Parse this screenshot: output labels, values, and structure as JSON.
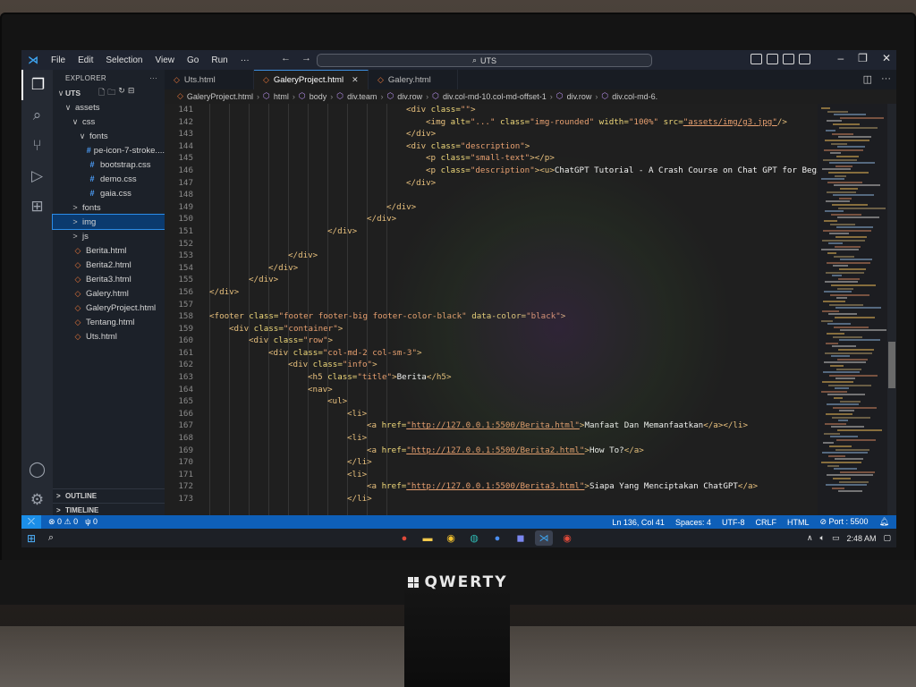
{
  "window": {
    "menu": [
      "File",
      "Edit",
      "Selection",
      "View",
      "Go",
      "Run",
      "···"
    ],
    "search_text": "UTS"
  },
  "activity_bar": {
    "icons": [
      "files-icon",
      "search-icon",
      "source-control-icon",
      "run-debug-icon",
      "extensions-icon",
      "account-icon",
      "settings-gear-icon"
    ]
  },
  "explorer": {
    "title": "EXPLORER",
    "more": "···",
    "root": "UTS",
    "tree": [
      {
        "indent": 1,
        "chev": "∨",
        "icon": "",
        "label": "assets"
      },
      {
        "indent": 2,
        "chev": "∨",
        "icon": "",
        "label": "css"
      },
      {
        "indent": 3,
        "chev": "∨",
        "icon": "",
        "label": "fonts"
      },
      {
        "indent": 4,
        "chev": "",
        "icon": "#",
        "kind": "css",
        "label": "pe-icon-7-stroke...."
      },
      {
        "indent": 3,
        "chev": "",
        "icon": "#",
        "kind": "css",
        "label": "bootstrap.css"
      },
      {
        "indent": 3,
        "chev": "",
        "icon": "#",
        "kind": "css",
        "label": "demo.css"
      },
      {
        "indent": 3,
        "chev": "",
        "icon": "#",
        "kind": "css",
        "label": "gaia.css"
      },
      {
        "indent": 2,
        "chev": ">",
        "icon": "",
        "label": "fonts"
      },
      {
        "indent": 2,
        "chev": ">",
        "icon": "",
        "label": "img",
        "selected": true
      },
      {
        "indent": 2,
        "chev": ">",
        "icon": "",
        "label": "js"
      },
      {
        "indent": 1,
        "chev": "",
        "icon": "◇",
        "kind": "html",
        "label": "Berita.html"
      },
      {
        "indent": 1,
        "chev": "",
        "icon": "◇",
        "kind": "html",
        "label": "Berita2.html"
      },
      {
        "indent": 1,
        "chev": "",
        "icon": "◇",
        "kind": "html",
        "label": "Berita3.html"
      },
      {
        "indent": 1,
        "chev": "",
        "icon": "◇",
        "kind": "html",
        "label": "Galery.html"
      },
      {
        "indent": 1,
        "chev": "",
        "icon": "◇",
        "kind": "html",
        "label": "GaleryProject.html"
      },
      {
        "indent": 1,
        "chev": "",
        "icon": "◇",
        "kind": "html",
        "label": "Tentang.html"
      },
      {
        "indent": 1,
        "chev": "",
        "icon": "◇",
        "kind": "html",
        "label": "Uts.html"
      }
    ],
    "outline": "OUTLINE",
    "timeline": "TIMELINE"
  },
  "tabs": [
    {
      "label": "Uts.html",
      "active": false
    },
    {
      "label": "GaleryProject.html",
      "active": true
    },
    {
      "label": "Galery.html",
      "active": false
    }
  ],
  "breadcrumb": [
    "GaleryProject.html",
    "html",
    "body",
    "div.team",
    "div.row",
    "div.col-md-10.col-md-offset-1",
    "div.row",
    "div.col-md-6."
  ],
  "code_lines": [
    {
      "n": "141",
      "indent": 20,
      "tokens": [
        [
          "tag",
          "<div "
        ],
        [
          "attr",
          "class="
        ],
        [
          "str",
          "\"\""
        ],
        [
          "tag",
          ">"
        ]
      ]
    },
    {
      "n": "142",
      "indent": 22,
      "tokens": [
        [
          "tag",
          "<img "
        ],
        [
          "attr",
          "alt="
        ],
        [
          "str",
          "\"...\""
        ],
        [
          "attr",
          " class="
        ],
        [
          "str",
          "\"img-rounded\""
        ],
        [
          "attr",
          " width="
        ],
        [
          "str",
          "\"100%\""
        ],
        [
          "attr",
          " src="
        ],
        [
          "url",
          "\"assets/img/g3.jpg\""
        ],
        [
          "tag",
          "/>"
        ]
      ]
    },
    {
      "n": "143",
      "indent": 20,
      "tokens": [
        [
          "tag",
          "</div>"
        ]
      ]
    },
    {
      "n": "144",
      "indent": 20,
      "tokens": [
        [
          "tag",
          "<div "
        ],
        [
          "attr",
          "class="
        ],
        [
          "str",
          "\"description\""
        ],
        [
          "tag",
          ">"
        ]
      ]
    },
    {
      "n": "145",
      "indent": 22,
      "tokens": [
        [
          "tag",
          "<p "
        ],
        [
          "attr",
          "class="
        ],
        [
          "str",
          "\"small-text\""
        ],
        [
          "tag",
          "></p>"
        ]
      ]
    },
    {
      "n": "146",
      "indent": 22,
      "tokens": [
        [
          "tag",
          "<p "
        ],
        [
          "attr",
          "class="
        ],
        [
          "str",
          "\"description\""
        ],
        [
          "tag",
          "><u>"
        ],
        [
          "txt",
          "ChatGPT Tutorial - A Crash Course on Chat GPT for Beginners"
        ],
        [
          "tag",
          "</"
        ]
      ]
    },
    {
      "n": "147",
      "indent": 20,
      "tokens": [
        [
          "tag",
          "</div>"
        ]
      ]
    },
    {
      "n": "148",
      "indent": 0,
      "tokens": []
    },
    {
      "n": "149",
      "indent": 18,
      "tokens": [
        [
          "tag",
          "</div>"
        ]
      ]
    },
    {
      "n": "150",
      "indent": 16,
      "tokens": [
        [
          "tag",
          "</div>"
        ]
      ]
    },
    {
      "n": "151",
      "indent": 12,
      "tokens": [
        [
          "tag",
          "</div>"
        ]
      ]
    },
    {
      "n": "152",
      "indent": 0,
      "tokens": []
    },
    {
      "n": "153",
      "indent": 8,
      "tokens": [
        [
          "tag",
          "</div>"
        ]
      ]
    },
    {
      "n": "154",
      "indent": 6,
      "tokens": [
        [
          "tag",
          "</div>"
        ]
      ]
    },
    {
      "n": "155",
      "indent": 4,
      "tokens": [
        [
          "tag",
          "</div>"
        ]
      ]
    },
    {
      "n": "156",
      "indent": 0,
      "tokens": [
        [
          "tag",
          "</div>"
        ]
      ]
    },
    {
      "n": "157",
      "indent": 0,
      "tokens": []
    },
    {
      "n": "158",
      "indent": 0,
      "tokens": [
        [
          "tag",
          "<footer "
        ],
        [
          "attr",
          "class="
        ],
        [
          "str",
          "\"footer footer-big footer-color-black\""
        ],
        [
          "attr",
          " data-color="
        ],
        [
          "str",
          "\"black\""
        ],
        [
          "tag",
          ">"
        ]
      ]
    },
    {
      "n": "159",
      "indent": 2,
      "tokens": [
        [
          "tag",
          "<div "
        ],
        [
          "attr",
          "class="
        ],
        [
          "str",
          "\"container\""
        ],
        [
          "tag",
          ">"
        ]
      ]
    },
    {
      "n": "160",
      "indent": 4,
      "tokens": [
        [
          "tag",
          "<div "
        ],
        [
          "attr",
          "class="
        ],
        [
          "str",
          "\"row\""
        ],
        [
          "tag",
          ">"
        ]
      ]
    },
    {
      "n": "161",
      "indent": 6,
      "tokens": [
        [
          "tag",
          "<div "
        ],
        [
          "attr",
          "class="
        ],
        [
          "str",
          "\"col-md-2 col-sm-3\""
        ],
        [
          "tag",
          ">"
        ]
      ]
    },
    {
      "n": "162",
      "indent": 8,
      "tokens": [
        [
          "tag",
          "<div "
        ],
        [
          "attr",
          "class="
        ],
        [
          "str",
          "\"info\""
        ],
        [
          "tag",
          ">"
        ]
      ]
    },
    {
      "n": "163",
      "indent": 10,
      "tokens": [
        [
          "tag",
          "<h5 "
        ],
        [
          "attr",
          "class="
        ],
        [
          "str",
          "\"title\""
        ],
        [
          "tag",
          ">"
        ],
        [
          "txt",
          "Berita"
        ],
        [
          "tag",
          "</h5>"
        ]
      ]
    },
    {
      "n": "164",
      "indent": 10,
      "tokens": [
        [
          "tag",
          "<nav>"
        ]
      ]
    },
    {
      "n": "165",
      "indent": 12,
      "tokens": [
        [
          "tag",
          "<ul>"
        ]
      ]
    },
    {
      "n": "166",
      "indent": 14,
      "tokens": [
        [
          "tag",
          "<li>"
        ]
      ]
    },
    {
      "n": "167",
      "indent": 16,
      "tokens": [
        [
          "tag",
          "<a "
        ],
        [
          "attr",
          "href="
        ],
        [
          "url",
          "\"http://127.0.0.1:5500/Berita.html\""
        ],
        [
          "tag",
          ">"
        ],
        [
          "txt",
          "Manfaat Dan Memanfaatkan"
        ],
        [
          "tag",
          "</a></li>"
        ]
      ]
    },
    {
      "n": "168",
      "indent": 14,
      "tokens": [
        [
          "tag",
          "<li>"
        ]
      ]
    },
    {
      "n": "169",
      "indent": 16,
      "tokens": [
        [
          "tag",
          "<a "
        ],
        [
          "attr",
          "href="
        ],
        [
          "url",
          "\"http://127.0.0.1:5500/Berita2.html\""
        ],
        [
          "tag",
          ">"
        ],
        [
          "txt",
          "How To?"
        ],
        [
          "tag",
          "</a>"
        ]
      ]
    },
    {
      "n": "170",
      "indent": 14,
      "tokens": [
        [
          "tag",
          "</li>"
        ]
      ]
    },
    {
      "n": "171",
      "indent": 14,
      "tokens": [
        [
          "tag",
          "<li>"
        ]
      ]
    },
    {
      "n": "172",
      "indent": 16,
      "tokens": [
        [
          "tag",
          "<a "
        ],
        [
          "attr",
          "href="
        ],
        [
          "url",
          "\"http://127.0.0.1:5500/Berita3.html\""
        ],
        [
          "tag",
          ">"
        ],
        [
          "txt",
          "Siapa Yang Menciptakan ChatGPT"
        ],
        [
          "tag",
          "</a>"
        ]
      ]
    },
    {
      "n": "173",
      "indent": 14,
      "tokens": [
        [
          "tag",
          "</li>"
        ]
      ]
    }
  ],
  "statusbar": {
    "errors": "⊗ 0 ⚠ 0",
    "ports": "ψ 0",
    "position": "Ln 136, Col 41",
    "spaces": "Spaces: 4",
    "encoding": "UTF-8",
    "eol": "CRLF",
    "language": "HTML",
    "port": "⊘ Port : 5500"
  },
  "taskbar": {
    "time": "2:48 AM"
  },
  "monitor_brand": "QWERTY",
  "colors": {
    "statusbar": "#0e5fb8",
    "accent": "#3d8fe0",
    "tag": "#e8c07d",
    "string": "#e8a070"
  }
}
